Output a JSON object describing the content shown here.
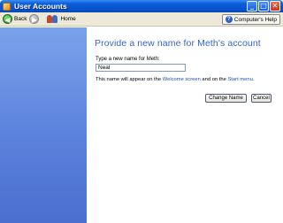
{
  "window": {
    "title": "User Accounts",
    "controls": [
      "minimize",
      "maximize",
      "close"
    ]
  },
  "toolbar": {
    "back_label": "Back",
    "home_label": "Home",
    "help_label": "Computer's Help",
    "icons": [
      "back-arrow-icon",
      "forward-arrow-icon",
      "home-icon",
      "help-icon"
    ]
  },
  "main": {
    "heading": "Provide a new name for Meth's account",
    "prompt": "Type a new name for Meth:",
    "name_value": "Neal",
    "info_prefix": "This name will appear on the ",
    "info_link1": "Welcome screen",
    "info_middle": " and on the ",
    "info_link2": "Start menu",
    "info_suffix": ".",
    "change_button": "Change Name",
    "cancel_button": "Cancel"
  },
  "colors": {
    "heading": "#3465c4",
    "sidebar_top": "#7aa2ea",
    "sidebar_bottom": "#4a6fd0",
    "titlebar": "#0853cf",
    "link": "#1d4fb8"
  }
}
